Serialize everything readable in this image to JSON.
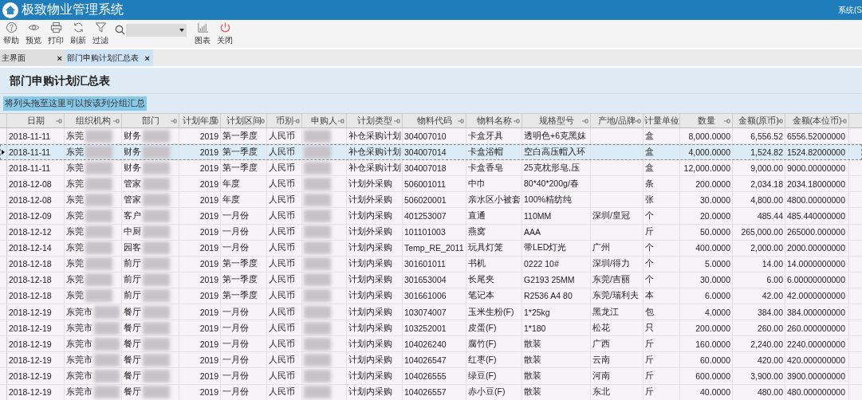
{
  "app_title": "极致物业管理系统",
  "user_menu": "系统(S",
  "toolbar": [
    {
      "kind": "button",
      "label": "帮助"
    },
    {
      "kind": "button",
      "label": "预览"
    },
    {
      "kind": "button",
      "label": "打印"
    },
    {
      "kind": "button",
      "label": "刷新"
    },
    {
      "kind": "button",
      "label": "过滤"
    },
    {
      "kind": "search"
    },
    {
      "kind": "button",
      "label": "图表"
    },
    {
      "kind": "button",
      "label": "关闭"
    }
  ],
  "tabs": [
    {
      "label": "主界面",
      "close": "×",
      "selected": false
    },
    {
      "label": "部门申购计划汇总表",
      "close": "×",
      "selected": true
    }
  ],
  "report_title": "部门申购计划汇总表",
  "group_hint": "将列头拖至这里可以按该列分组汇总",
  "columns": [
    "日期",
    "组织机构",
    "部门",
    "计划年度",
    "计划区间",
    "币别",
    "申购人",
    "计划类型",
    "物料代码",
    "物料名称",
    "规格型号",
    "产地/品牌",
    "计量单位",
    "数量",
    "金额(原币)",
    "金额(本位币)"
  ],
  "rows": [
    {
      "selected": false,
      "date": "2018-11-11",
      "org": "东莞",
      "dept": "财务",
      "year": "2019",
      "period": "第一季度",
      "currency": "人民币",
      "type": "补仓采购计划",
      "code": "304007010",
      "name": "卡盒牙具",
      "spec": "透明色+6克黑妹",
      "unit": "盒",
      "qty": "8,000.0000",
      "amount": "6,556.52",
      "base": "6556.52000000"
    },
    {
      "selected": true,
      "date": "2018-11-11",
      "org": "东莞",
      "dept": "财务",
      "year": "2019",
      "period": "第一季度",
      "currency": "人民币",
      "type": "补仓采购计划",
      "code": "304007014",
      "name": "卡盒浴帽",
      "spec": "空白高压帽入环",
      "unit": "盒",
      "qty": "4,000.0000",
      "amount": "1,524.82",
      "base": "1524.82000000"
    },
    {
      "selected": false,
      "date": "2018-11-11",
      "org": "东莞",
      "dept": "财务",
      "year": "2019",
      "period": "第一季度",
      "currency": "人民币",
      "type": "补仓采购计划",
      "code": "304007018",
      "name": "卡盒香皂",
      "spec": "25克枕形皂,压",
      "unit": "盒",
      "qty": "12,000.0000",
      "amount": "9,000.00",
      "base": "9000.00000000"
    },
    {
      "selected": false,
      "date": "2018-12-08",
      "org": "东莞",
      "dept": "管家",
      "year": "2019",
      "period": "年度",
      "currency": "人民币",
      "type": "计划外采购",
      "code": "506001011",
      "name": "中巾",
      "spec": "80*40*200g/春",
      "unit": "条",
      "qty": "200.0000",
      "amount": "2,034.18",
      "base": "2034.18000000"
    },
    {
      "selected": false,
      "date": "2018-12-08",
      "org": "东莞",
      "dept": "管家",
      "year": "2019",
      "period": "年度",
      "currency": "人民币",
      "type": "计划外采购",
      "code": "506020001",
      "name": "亲水区小被套",
      "spec": "100%精纺纯",
      "unit": "张",
      "qty": "30.0000",
      "amount": "4,800.00",
      "base": "4800.00000000"
    },
    {
      "selected": false,
      "date": "2018-12-09",
      "org": "东莞",
      "dept": "客户",
      "year": "2019",
      "period": "一月份",
      "currency": "人民币",
      "type": "计划内采购",
      "code": "401253007",
      "name": "直通",
      "spec": "110MM",
      "origin": "深圳/皇冠",
      "unit": "个",
      "qty": "20.0000",
      "amount": "485.44",
      "base": "485.440000000"
    },
    {
      "selected": false,
      "date": "2018-12-12",
      "org": "东莞",
      "dept": "中厨",
      "year": "2019",
      "period": "一月份",
      "currency": "人民币",
      "type": "计划外采购",
      "code": "101101003",
      "name": "燕窝",
      "spec": "AAA",
      "unit": "斤",
      "qty": "50.0000",
      "amount": "265,000.00",
      "base": "265000.000000"
    },
    {
      "selected": false,
      "date": "2018-12-14",
      "org": "东莞",
      "dept": "园客",
      "year": "2019",
      "period": "一月份",
      "currency": "人民币",
      "type": "计划内采购",
      "code": "Temp_RE_2011",
      "name": "玩具灯笼",
      "spec": "带LED灯光",
      "origin": "广州",
      "unit": "个",
      "qty": "400.0000",
      "amount": "2,000.00",
      "base": "2000.00000000"
    },
    {
      "selected": false,
      "date": "2018-12-18",
      "org": "东莞",
      "dept": "前厅",
      "year": "2019",
      "period": "第一季度",
      "currency": "人民币",
      "type": "计划内采购",
      "code": "301601011",
      "name": "书机",
      "spec": "0222 10#",
      "origin": "深圳/得力",
      "unit": "个",
      "qty": "5.0000",
      "amount": "14.00",
      "base": "14.0000000000"
    },
    {
      "selected": false,
      "date": "2018-12-18",
      "org": "东莞",
      "dept": "前厅",
      "year": "2019",
      "period": "第一季度",
      "currency": "人民币",
      "type": "计划内采购",
      "code": "301653004",
      "name": "长尾夹",
      "spec": "G2193 25MM",
      "origin": "东莞/吉丽",
      "unit": "个",
      "qty": "30.0000",
      "amount": "6.00",
      "base": "6.00000000000"
    },
    {
      "selected": false,
      "date": "2018-12-18",
      "org": "东莞",
      "dept": "前厅",
      "year": "2019",
      "period": "第一季度",
      "currency": "人民币",
      "type": "计划内采购",
      "code": "301661006",
      "name": "笔记本",
      "spec": "R2536 A4 80",
      "origin": "东莞/瑞利夫",
      "unit": "本",
      "qty": "6.0000",
      "amount": "42.00",
      "base": "42.0000000000"
    },
    {
      "selected": false,
      "date": "2018-12-19",
      "org": "东莞市",
      "dept": "餐厅",
      "year": "2019",
      "period": "一月份",
      "currency": "人民币",
      "type": "计划内采购",
      "code": "103074007",
      "name": "玉米生粉(F)",
      "spec": "1*25kg",
      "origin": "黑龙江",
      "unit": "包",
      "qty": "4.0000",
      "amount": "384.00",
      "base": "384.000000000"
    },
    {
      "selected": false,
      "date": "2018-12-19",
      "org": "东莞市",
      "dept": "餐厅",
      "year": "2019",
      "period": "一月份",
      "currency": "人民币",
      "type": "计划内采购",
      "code": "103252001",
      "name": "皮蛋(F)",
      "spec": "1*180",
      "origin": "松花",
      "unit": "只",
      "qty": "200.0000",
      "amount": "260.00",
      "base": "260.000000000"
    },
    {
      "selected": false,
      "date": "2018-12-19",
      "org": "东莞市",
      "dept": "餐厅",
      "year": "2019",
      "period": "一月份",
      "currency": "人民币",
      "type": "计划内采购",
      "code": "104026240",
      "name": "腐竹(F)",
      "spec": "散装",
      "origin": "广西",
      "unit": "斤",
      "qty": "160.0000",
      "amount": "2,240.00",
      "base": "2240.00000000"
    },
    {
      "selected": false,
      "date": "2018-12-19",
      "org": "东莞市",
      "dept": "餐厅",
      "year": "2019",
      "period": "一月份",
      "currency": "人民币",
      "type": "计划内采购",
      "code": "104026547",
      "name": "红枣(F)",
      "spec": "散装",
      "origin": "云南",
      "unit": "斤",
      "qty": "60.0000",
      "amount": "420.00",
      "base": "420.000000000"
    },
    {
      "selected": false,
      "date": "2018-12-19",
      "org": "东莞市",
      "dept": "餐厅",
      "year": "2019",
      "period": "一月份",
      "currency": "人民币",
      "type": "计划内采购",
      "code": "104026555",
      "name": "绿豆(F)",
      "spec": "散装",
      "origin": "河南",
      "unit": "斤",
      "qty": "600.0000",
      "amount": "3,900.00",
      "base": "3900.00000000"
    },
    {
      "selected": false,
      "date": "2018-12-19",
      "org": "东莞市",
      "dept": "餐厅",
      "year": "2019",
      "period": "一月份",
      "currency": "人民币",
      "type": "计划内采购",
      "code": "104026557",
      "name": "赤小豆(F)",
      "spec": "散装",
      "origin": "东北",
      "unit": "斤",
      "qty": "40.0000",
      "amount": "480.00",
      "base": "480.000000000"
    }
  ]
}
